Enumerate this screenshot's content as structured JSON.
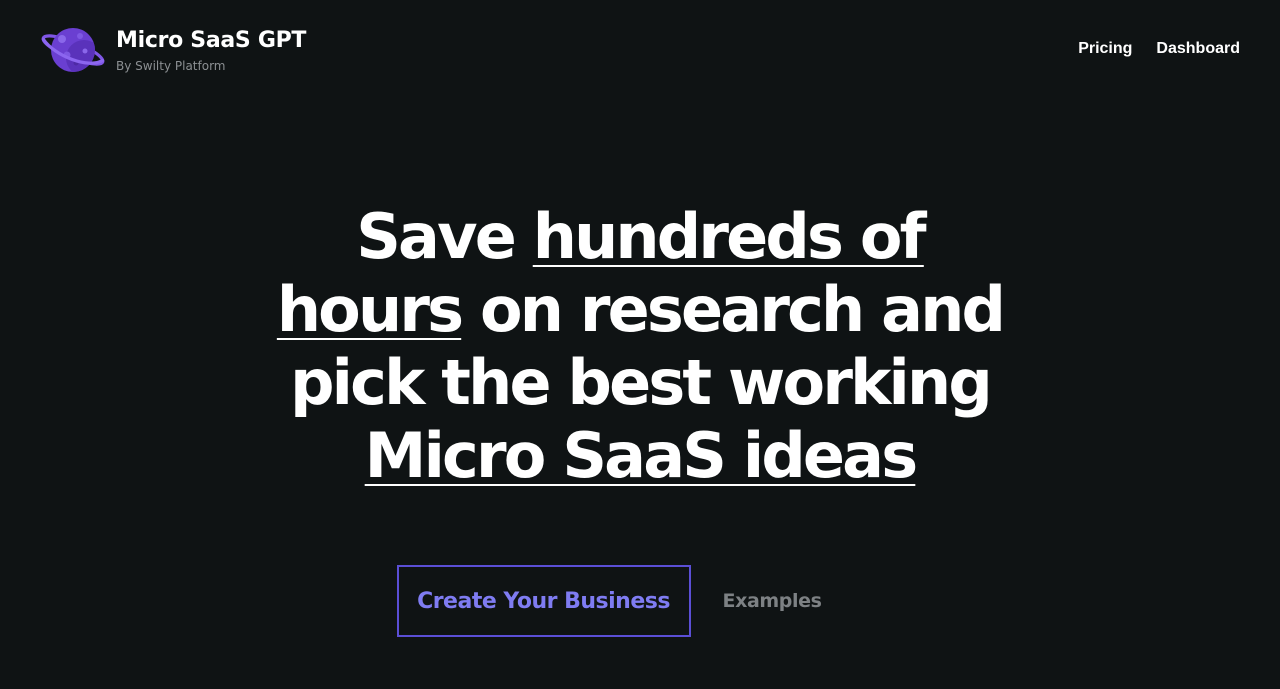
{
  "brand": {
    "title": "Micro SaaS GPT",
    "subtitle": "By Swilty Platform",
    "logo_icon": "planet-icon"
  },
  "nav": {
    "pricing": "Pricing",
    "dashboard": "Dashboard"
  },
  "hero": {
    "line1_plain": "Save ",
    "line1_underlined": "hundreds of",
    "line2_underlined": "hours",
    "line2_plain": " on research and",
    "line3": "pick the best working",
    "line4_underlined": "Micro SaaS ideas"
  },
  "cta": {
    "primary": "Create Your Business",
    "secondary": "Examples"
  },
  "colors": {
    "background": "#0f1314",
    "accent": "#7f7cf2",
    "accent_border": "#5b4fd6",
    "planet": "#6a3fd1",
    "muted": "#7d8184"
  }
}
